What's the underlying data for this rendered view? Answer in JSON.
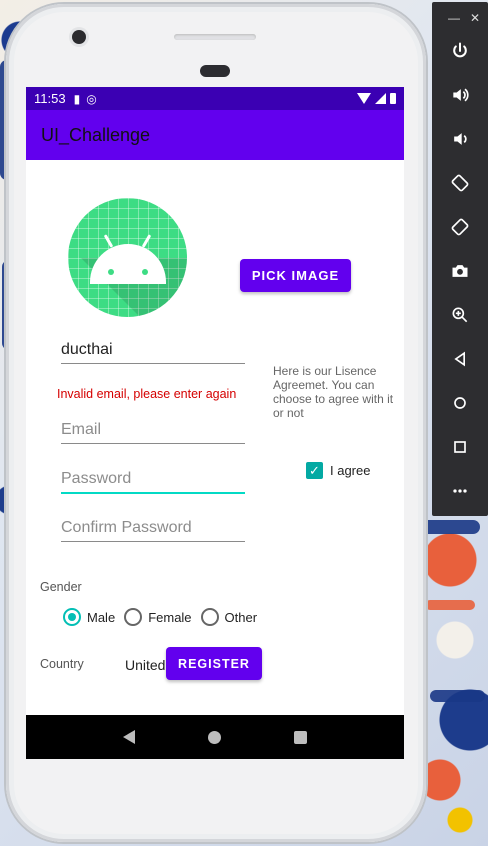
{
  "status_bar": {
    "time": "11:53"
  },
  "app_bar": {
    "title": "UI_Challenge"
  },
  "form": {
    "pick_image_label": "PICK IMAGE",
    "username_value": "ducthai",
    "error_message": "Invalid email, please enter again",
    "email_placeholder": "Email",
    "password_placeholder": "Password",
    "confirm_password_placeholder": "Confirm Password",
    "licence_text": "Here is our Lisence Agreemet. You can choose to agree with it or not",
    "agree_label": "I agree",
    "agree_checked": true,
    "gender_label": "Gender",
    "gender_options": [
      "Male",
      "Female",
      "Other"
    ],
    "gender_selected": "Male",
    "country_label": "Country",
    "country_value": "United",
    "register_label": "REGISTER"
  },
  "emulator_toolbar": {
    "buttons": [
      "power-icon",
      "volume-up-icon",
      "volume-down-icon",
      "rotate-left-icon",
      "rotate-right-icon",
      "camera-icon",
      "zoom-icon",
      "back-icon",
      "home-icon",
      "overview-icon",
      "more-icon"
    ]
  },
  "colors": {
    "primary": "#6200ee",
    "primary_dark": "#3b00b3",
    "accent": "#03dac5",
    "error": "#d50000"
  }
}
